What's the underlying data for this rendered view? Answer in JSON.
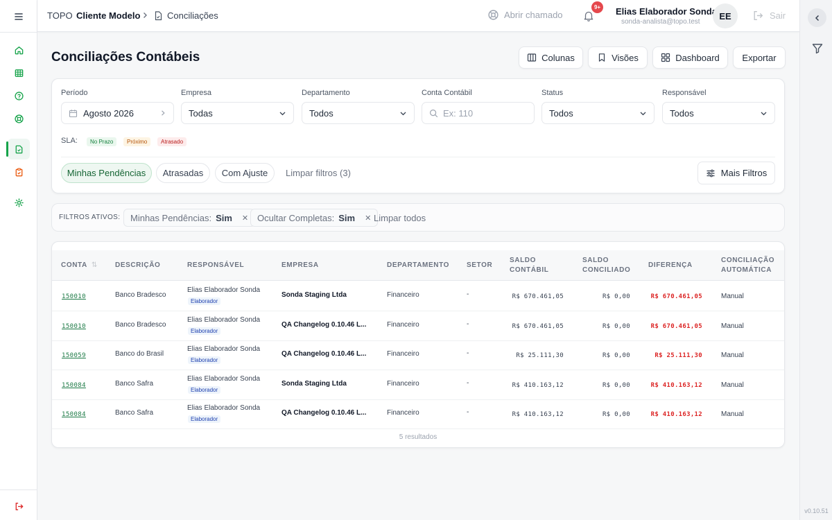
{
  "breadcrumb": {
    "org": "TOPO",
    "client": "Cliente Modelo",
    "page": "Conciliações"
  },
  "topbar": {
    "help_label": "Abrir chamado",
    "notifications_badge": "9+",
    "user_name": "Elias Elaborador Sonda",
    "user_email": "sonda-analista@topo.test",
    "avatar_initials": "EE",
    "logout_label": "Sair"
  },
  "sidebar": {
    "items": [
      {
        "icon": "home-icon"
      },
      {
        "icon": "table-icon"
      },
      {
        "icon": "help-circle-icon"
      },
      {
        "icon": "lifebuoy-icon"
      },
      {
        "icon": "file-check-icon",
        "active": true
      },
      {
        "icon": "clipboard-check-icon"
      },
      {
        "icon": "settings-icon"
      }
    ],
    "logout_icon": "logout-icon"
  },
  "right_rail": {
    "version": "v0.10.51"
  },
  "page": {
    "title": "Conciliações Contábeis",
    "actions": {
      "columns": "Colunas",
      "views": "Visões",
      "dashboard": "Dashboard",
      "export": "Exportar"
    }
  },
  "filters": {
    "periodo": {
      "label": "Período",
      "value": "Agosto 2026"
    },
    "empresa": {
      "label": "Empresa",
      "value": "Todas"
    },
    "departamento": {
      "label": "Departamento",
      "value": "Todos"
    },
    "conta": {
      "label": "Conta Contábil",
      "placeholder": "Ex: 110"
    },
    "status": {
      "label": "Status",
      "value": "Todos"
    },
    "responsavel": {
      "label": "Responsável",
      "value": "Todos"
    },
    "sla": {
      "label": "SLA:",
      "badges": [
        {
          "label": "No Prazo",
          "color": "#15803d",
          "bg": "#eaf7ee"
        },
        {
          "label": "Próximo",
          "color": "#b45309",
          "bg": "#fdf4e3"
        },
        {
          "label": "Atrasado",
          "color": "#b91c1c",
          "bg": "#fdecec"
        }
      ]
    },
    "quick": {
      "mine": "Minhas Pendências",
      "late": "Atrasadas",
      "adjust": "Com Ajuste",
      "clear": "Limpar filtros (3)"
    },
    "more": "Mais Filtros"
  },
  "active_filters": {
    "label": "FILTROS ATIVOS:",
    "chips": [
      {
        "name": "Minhas Pendências:",
        "value": "Sim"
      },
      {
        "name": "Ocultar Completas:",
        "value": "Sim"
      }
    ],
    "clear_all": "Limpar todos"
  },
  "table": {
    "headers": {
      "conta": "CONTA",
      "descricao": "DESCRIÇÃO",
      "responsavel": "RESPONSÁVEL",
      "empresa": "EMPRESA",
      "departamento": "DEPARTAMENTO",
      "setor": "SETOR",
      "saldo_contabil_1": "SALDO",
      "saldo_contabil_2": "CONTÁBIL",
      "saldo_conciliado_1": "SALDO",
      "saldo_conciliado_2": "CONCILIADO",
      "diferenca": "DIFERENÇA",
      "auto_1": "CONCILIAÇÃO",
      "auto_2": "AUTOMÁTICA"
    },
    "rows": [
      {
        "conta": "150010",
        "descricao": "Banco Bradesco",
        "responsavel": "Elias Elaborador Sonda",
        "role": "Elaborador",
        "empresa": "Sonda Staging Ltda",
        "departamento": "Financeiro",
        "setor": "-",
        "saldo_contabil": "R$ 670.461,05",
        "saldo_conciliado": "R$ 0,00",
        "diferenca": "R$ 670.461,05",
        "conciliacao": "Manual"
      },
      {
        "conta": "150010",
        "descricao": "Banco Bradesco",
        "responsavel": "Elias Elaborador Sonda",
        "role": "Elaborador",
        "empresa": "QA Changelog 0.10.46 L...",
        "departamento": "Financeiro",
        "setor": "-",
        "saldo_contabil": "R$ 670.461,05",
        "saldo_conciliado": "R$ 0,00",
        "diferenca": "R$ 670.461,05",
        "conciliacao": "Manual"
      },
      {
        "conta": "150059",
        "descricao": "Banco do Brasil",
        "responsavel": "Elias Elaborador Sonda",
        "role": "Elaborador",
        "empresa": "QA Changelog 0.10.46 L...",
        "departamento": "Financeiro",
        "setor": "-",
        "saldo_contabil": "R$ 25.111,30",
        "saldo_conciliado": "R$ 0,00",
        "diferenca": "R$ 25.111,30",
        "conciliacao": "Manual"
      },
      {
        "conta": "150084",
        "descricao": "Banco Safra",
        "responsavel": "Elias Elaborador Sonda",
        "role": "Elaborador",
        "empresa": "Sonda Staging Ltda",
        "departamento": "Financeiro",
        "setor": "-",
        "saldo_contabil": "R$ 410.163,12",
        "saldo_conciliado": "R$ 0,00",
        "diferenca": "R$ 410.163,12",
        "conciliacao": "Manual"
      },
      {
        "conta": "150084",
        "descricao": "Banco Safra",
        "responsavel": "Elias Elaborador Sonda",
        "role": "Elaborador",
        "empresa": "QA Changelog 0.10.46 L...",
        "departamento": "Financeiro",
        "setor": "-",
        "saldo_contabil": "R$ 410.163,12",
        "saldo_conciliado": "R$ 0,00",
        "diferenca": "R$ 410.163,12",
        "conciliacao": "Manual"
      }
    ],
    "results": "5 resultados"
  }
}
